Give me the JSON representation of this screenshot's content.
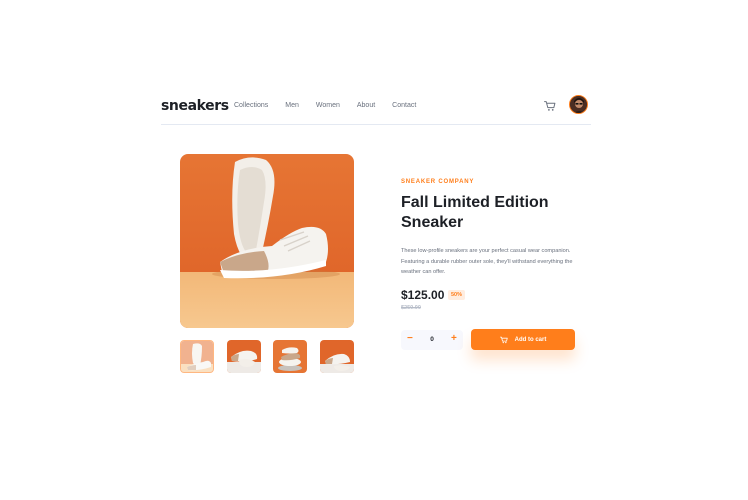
{
  "header": {
    "logo": "sneakers",
    "nav": [
      "Collections",
      "Men",
      "Women",
      "About",
      "Contact"
    ]
  },
  "product": {
    "company": "SNEAKER COMPANY",
    "title": "Fall Limited Edition Sneaker",
    "description": "These low-profile sneakers are your perfect casual wear companion. Featuring a durable rubber outer sole, they'll withstand everything the weather can offer.",
    "price": "$125.00",
    "discount": "50%",
    "original_price": "$250.00",
    "quantity": "0",
    "minus": "−",
    "plus": "+",
    "add_to_cart": "Add to cart"
  },
  "colors": {
    "accent": "#ff7e1b",
    "accent_pale": "#ffede0",
    "dark": "#1d2026",
    "muted": "#69707d"
  },
  "icons": [
    "cart-icon",
    "avatar",
    "minus-icon",
    "plus-icon"
  ]
}
